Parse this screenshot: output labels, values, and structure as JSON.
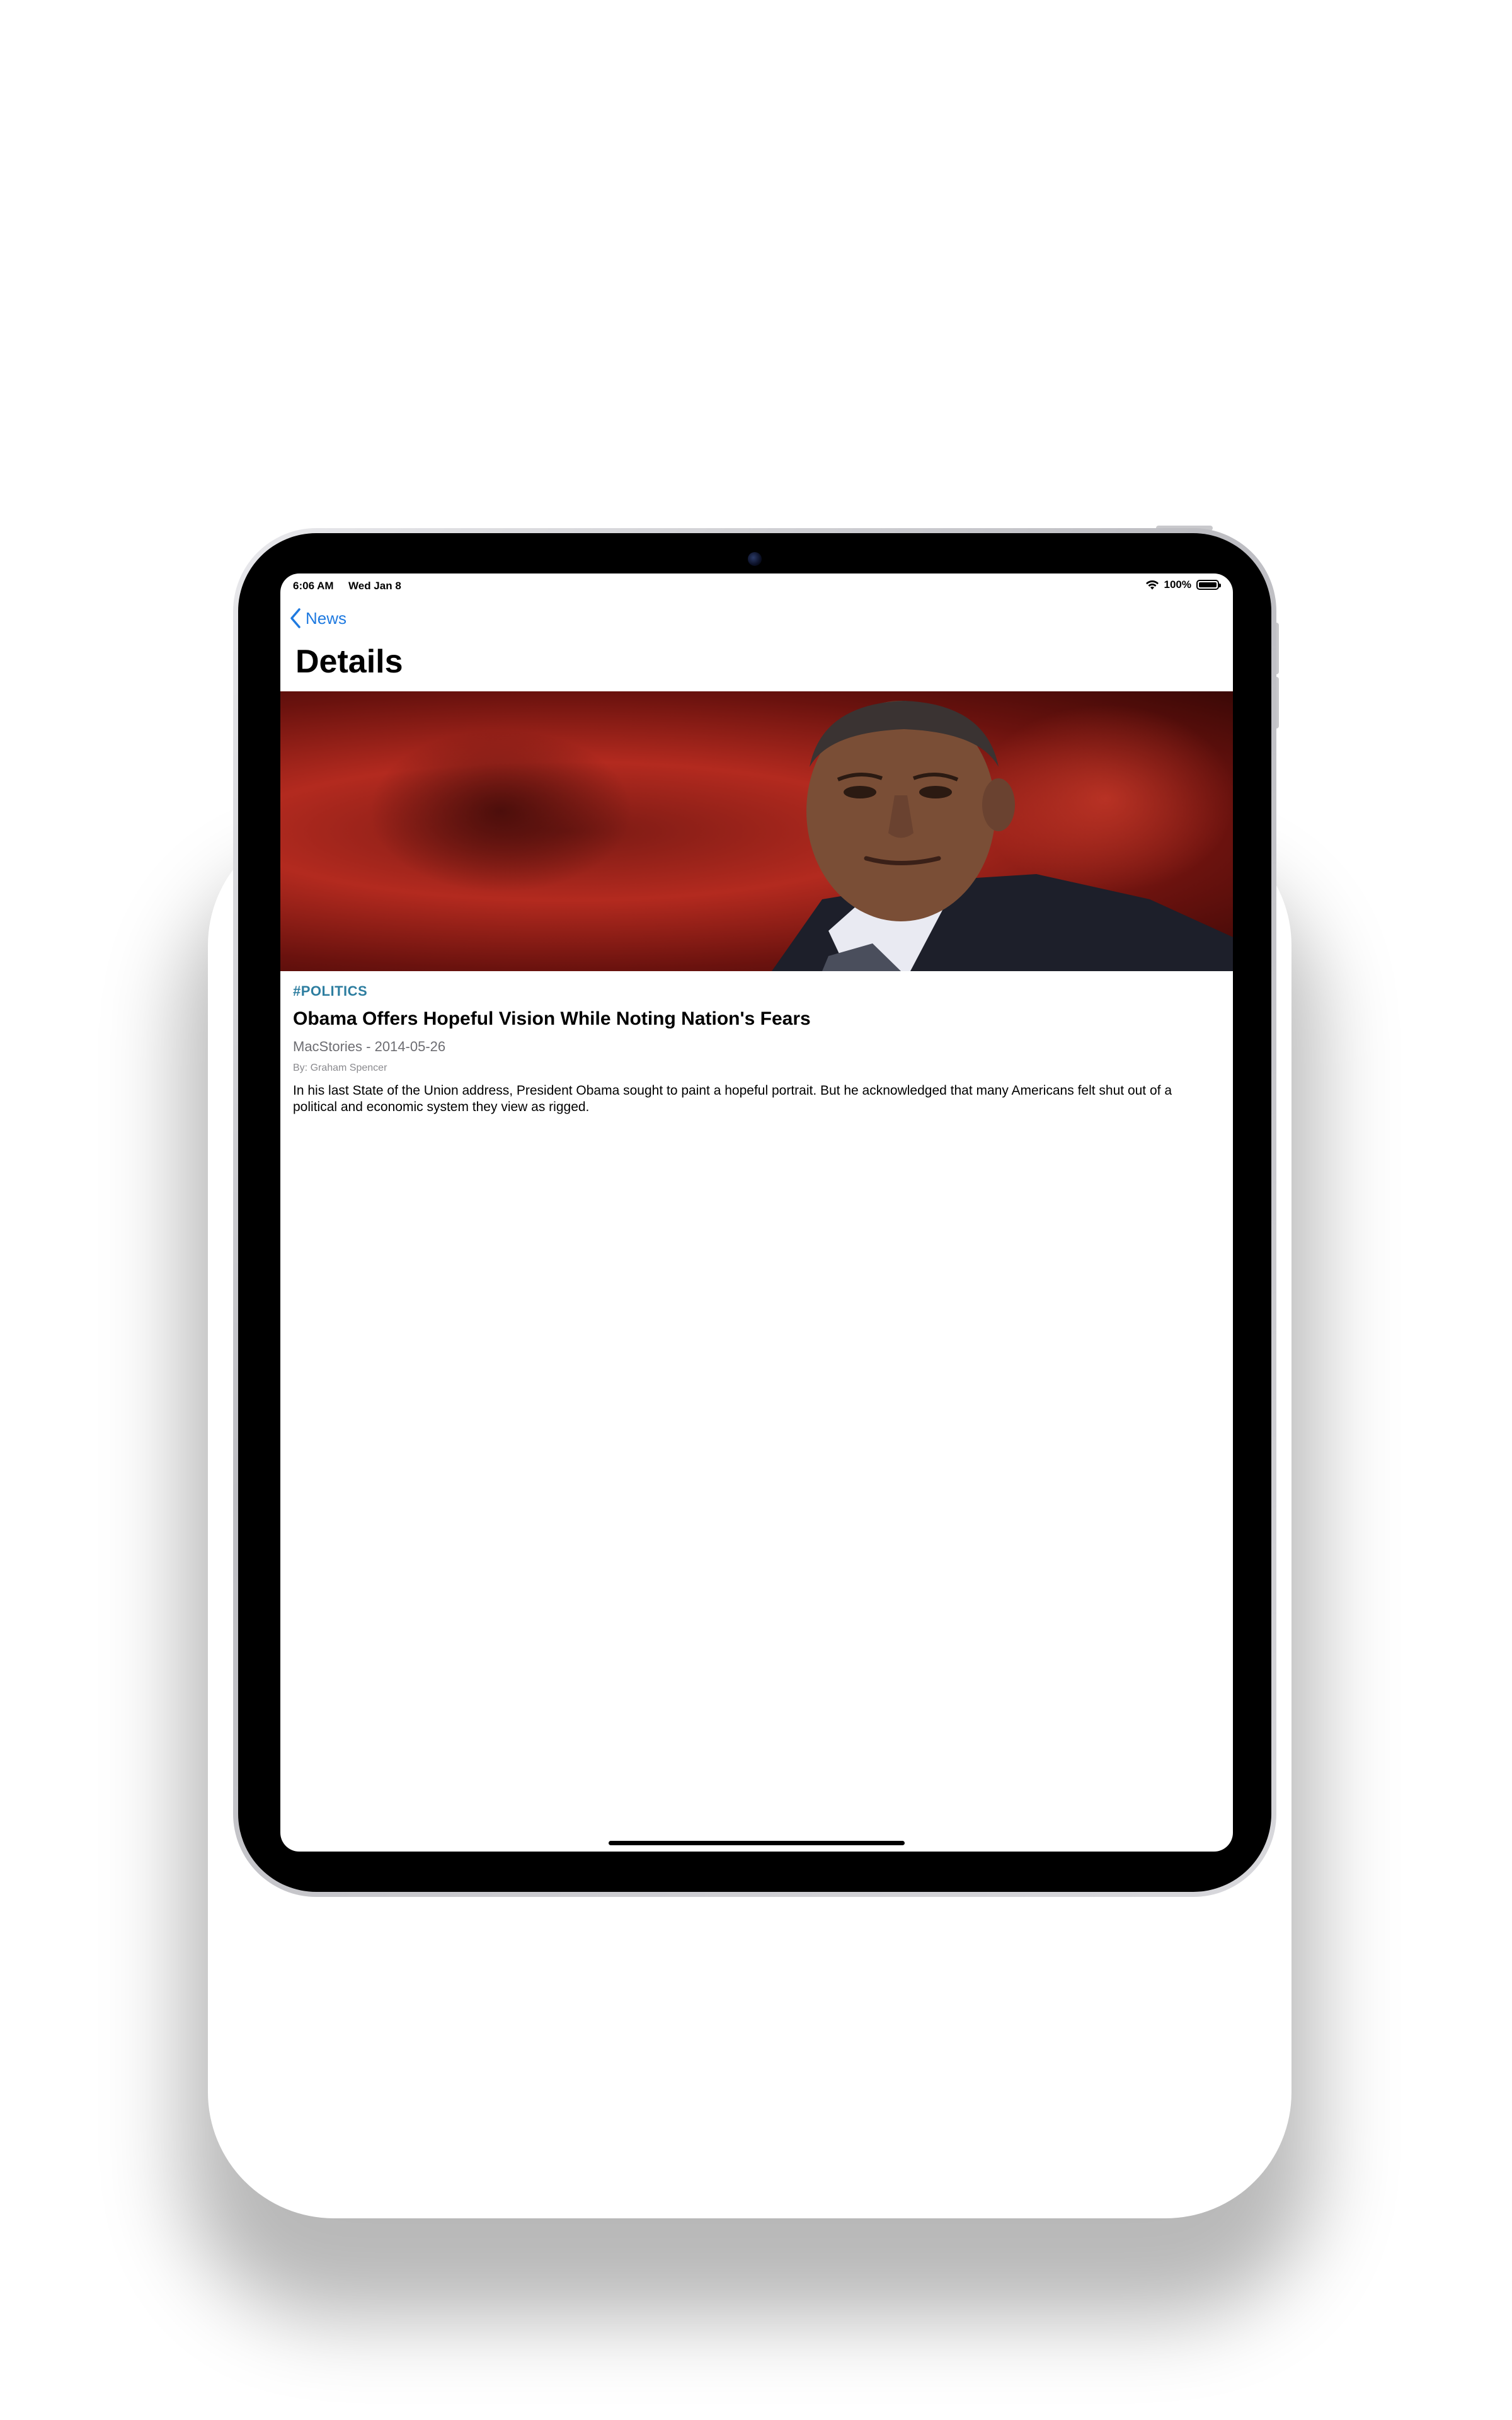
{
  "status_bar": {
    "time": "6:06 AM",
    "date": "Wed Jan 8",
    "battery": "100%",
    "icons": [
      "wifi-icon",
      "battery-icon"
    ]
  },
  "nav": {
    "back_label": "News",
    "back_icon": "chevron-left-icon",
    "title": "Details"
  },
  "article": {
    "tag": "#POLITICS",
    "headline": "Obama Offers Hopeful Vision While Noting Nation's Fears",
    "source_date": "MacStories - 2014-05-26",
    "author": "By: Graham Spencer",
    "body": "In his last State of the Union address, President Obama sought to paint a hopeful portrait. But he acknowledged that many Americans felt shut out of a political and economic system they view as rigged."
  },
  "colors": {
    "accent": "#1f7ae0",
    "tag": "#2e7ea0"
  }
}
